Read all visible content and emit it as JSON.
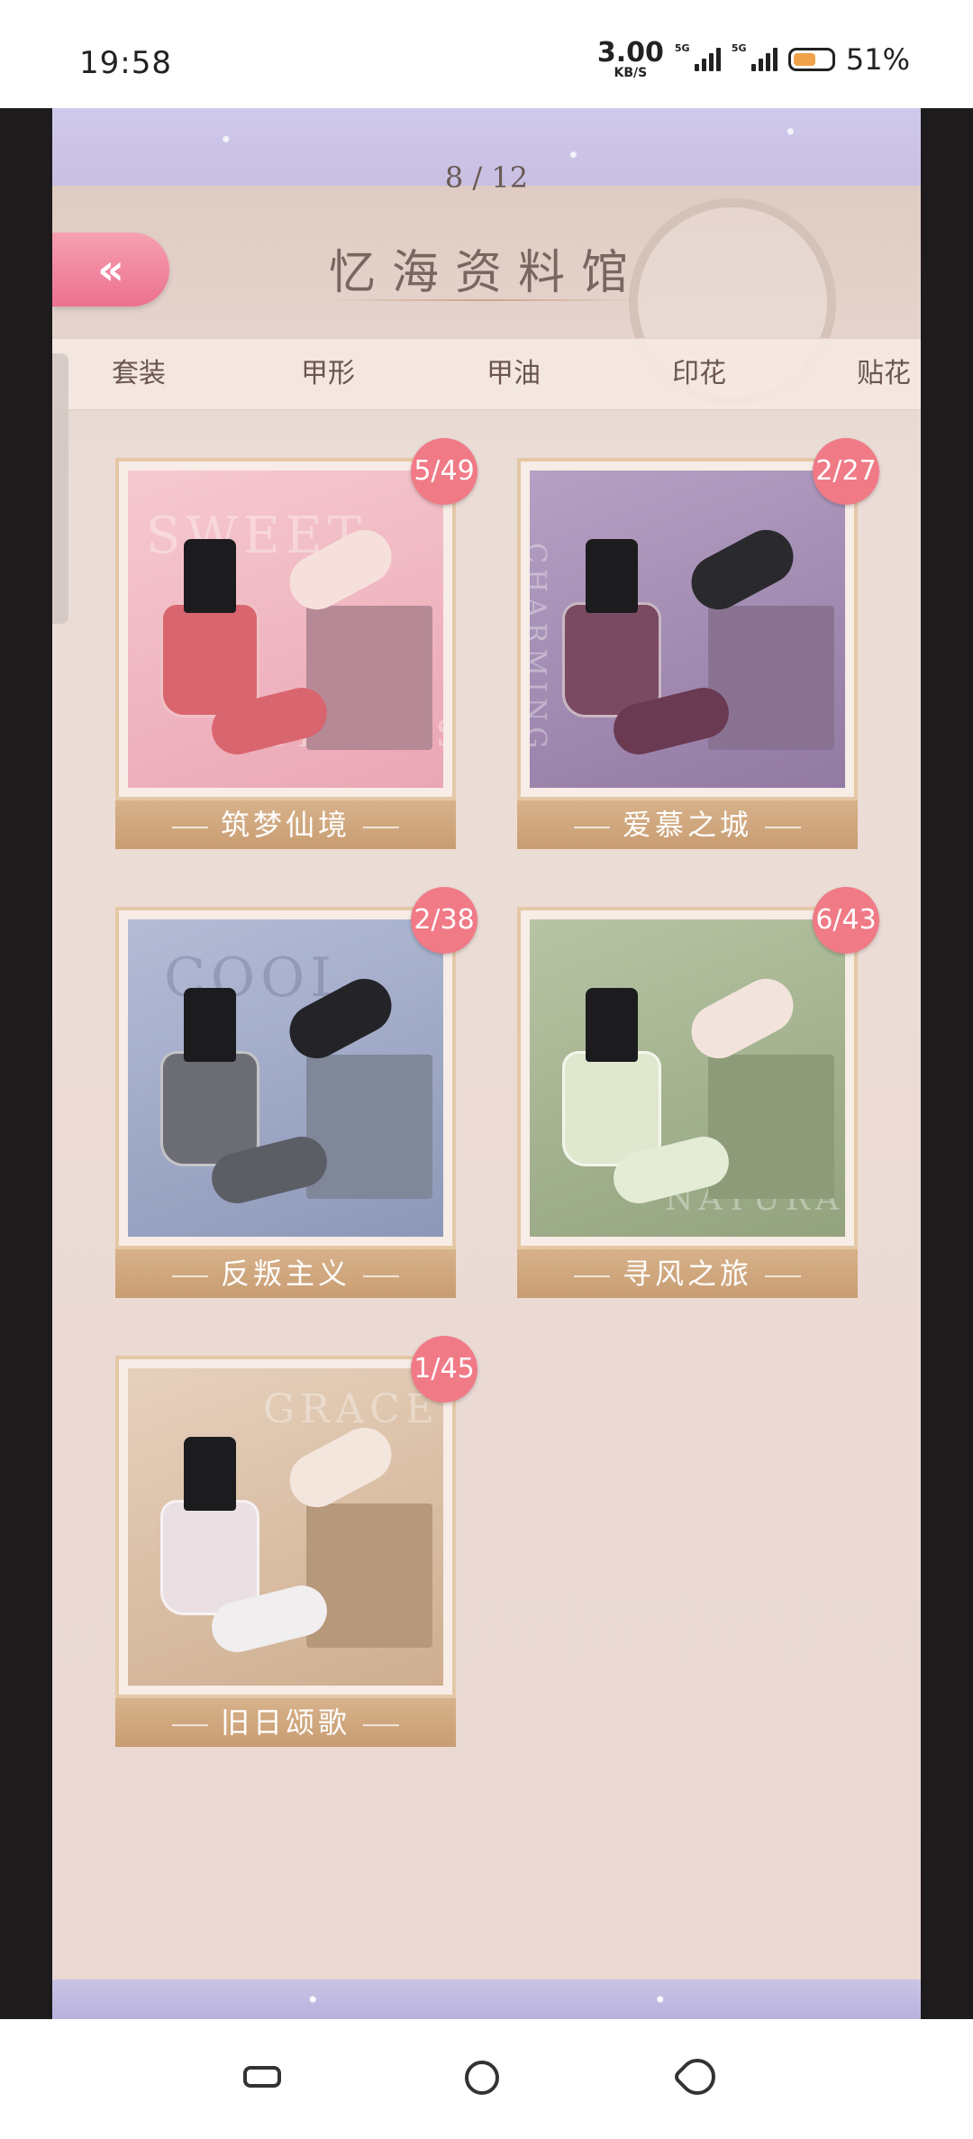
{
  "status_bar": {
    "time": "19:58",
    "speed_value": "3.00",
    "speed_unit": "KB/S",
    "net1": "5G",
    "net2": "5G",
    "battery": "51%"
  },
  "header": {
    "page_indicator": "8 / 12",
    "title": "忆海资料馆"
  },
  "tabs": [
    {
      "label": "套装"
    },
    {
      "label": "甲形"
    },
    {
      "label": "甲油"
    },
    {
      "label": "印花"
    },
    {
      "label": "贴花"
    }
  ],
  "cards": [
    {
      "name": "筑梦仙境",
      "progress": "5/49",
      "watermark": "SWEET",
      "watermark2": "DREAMS",
      "bg": "#f0b9c3",
      "polish": "#d9656e",
      "box": "#b58a96"
    },
    {
      "name": "爱慕之城",
      "progress": "2/27",
      "watermark": "CHARMING",
      "watermark2": "",
      "bg": "#a58eb3",
      "polish": "#7a4a63",
      "box": "#8a7392"
    },
    {
      "name": "反叛主义",
      "progress": "2/38",
      "watermark": "COOL",
      "watermark2": "",
      "bg": "#9ea9c6",
      "polish": "#6b6c74",
      "box": "#7f8799"
    },
    {
      "name": "寻风之旅",
      "progress": "6/43",
      "watermark": "NATURAL",
      "watermark2": "",
      "bg": "#a9b895",
      "polish": "#dfe8cf",
      "box": "#8e9b78"
    },
    {
      "name": "旧日颂歌",
      "progress": "1/45",
      "watermark": "GRACE",
      "watermark2": "",
      "bg": "#dcc0a6",
      "polish": "#eadfe3",
      "box": "#b6987a"
    }
  ]
}
